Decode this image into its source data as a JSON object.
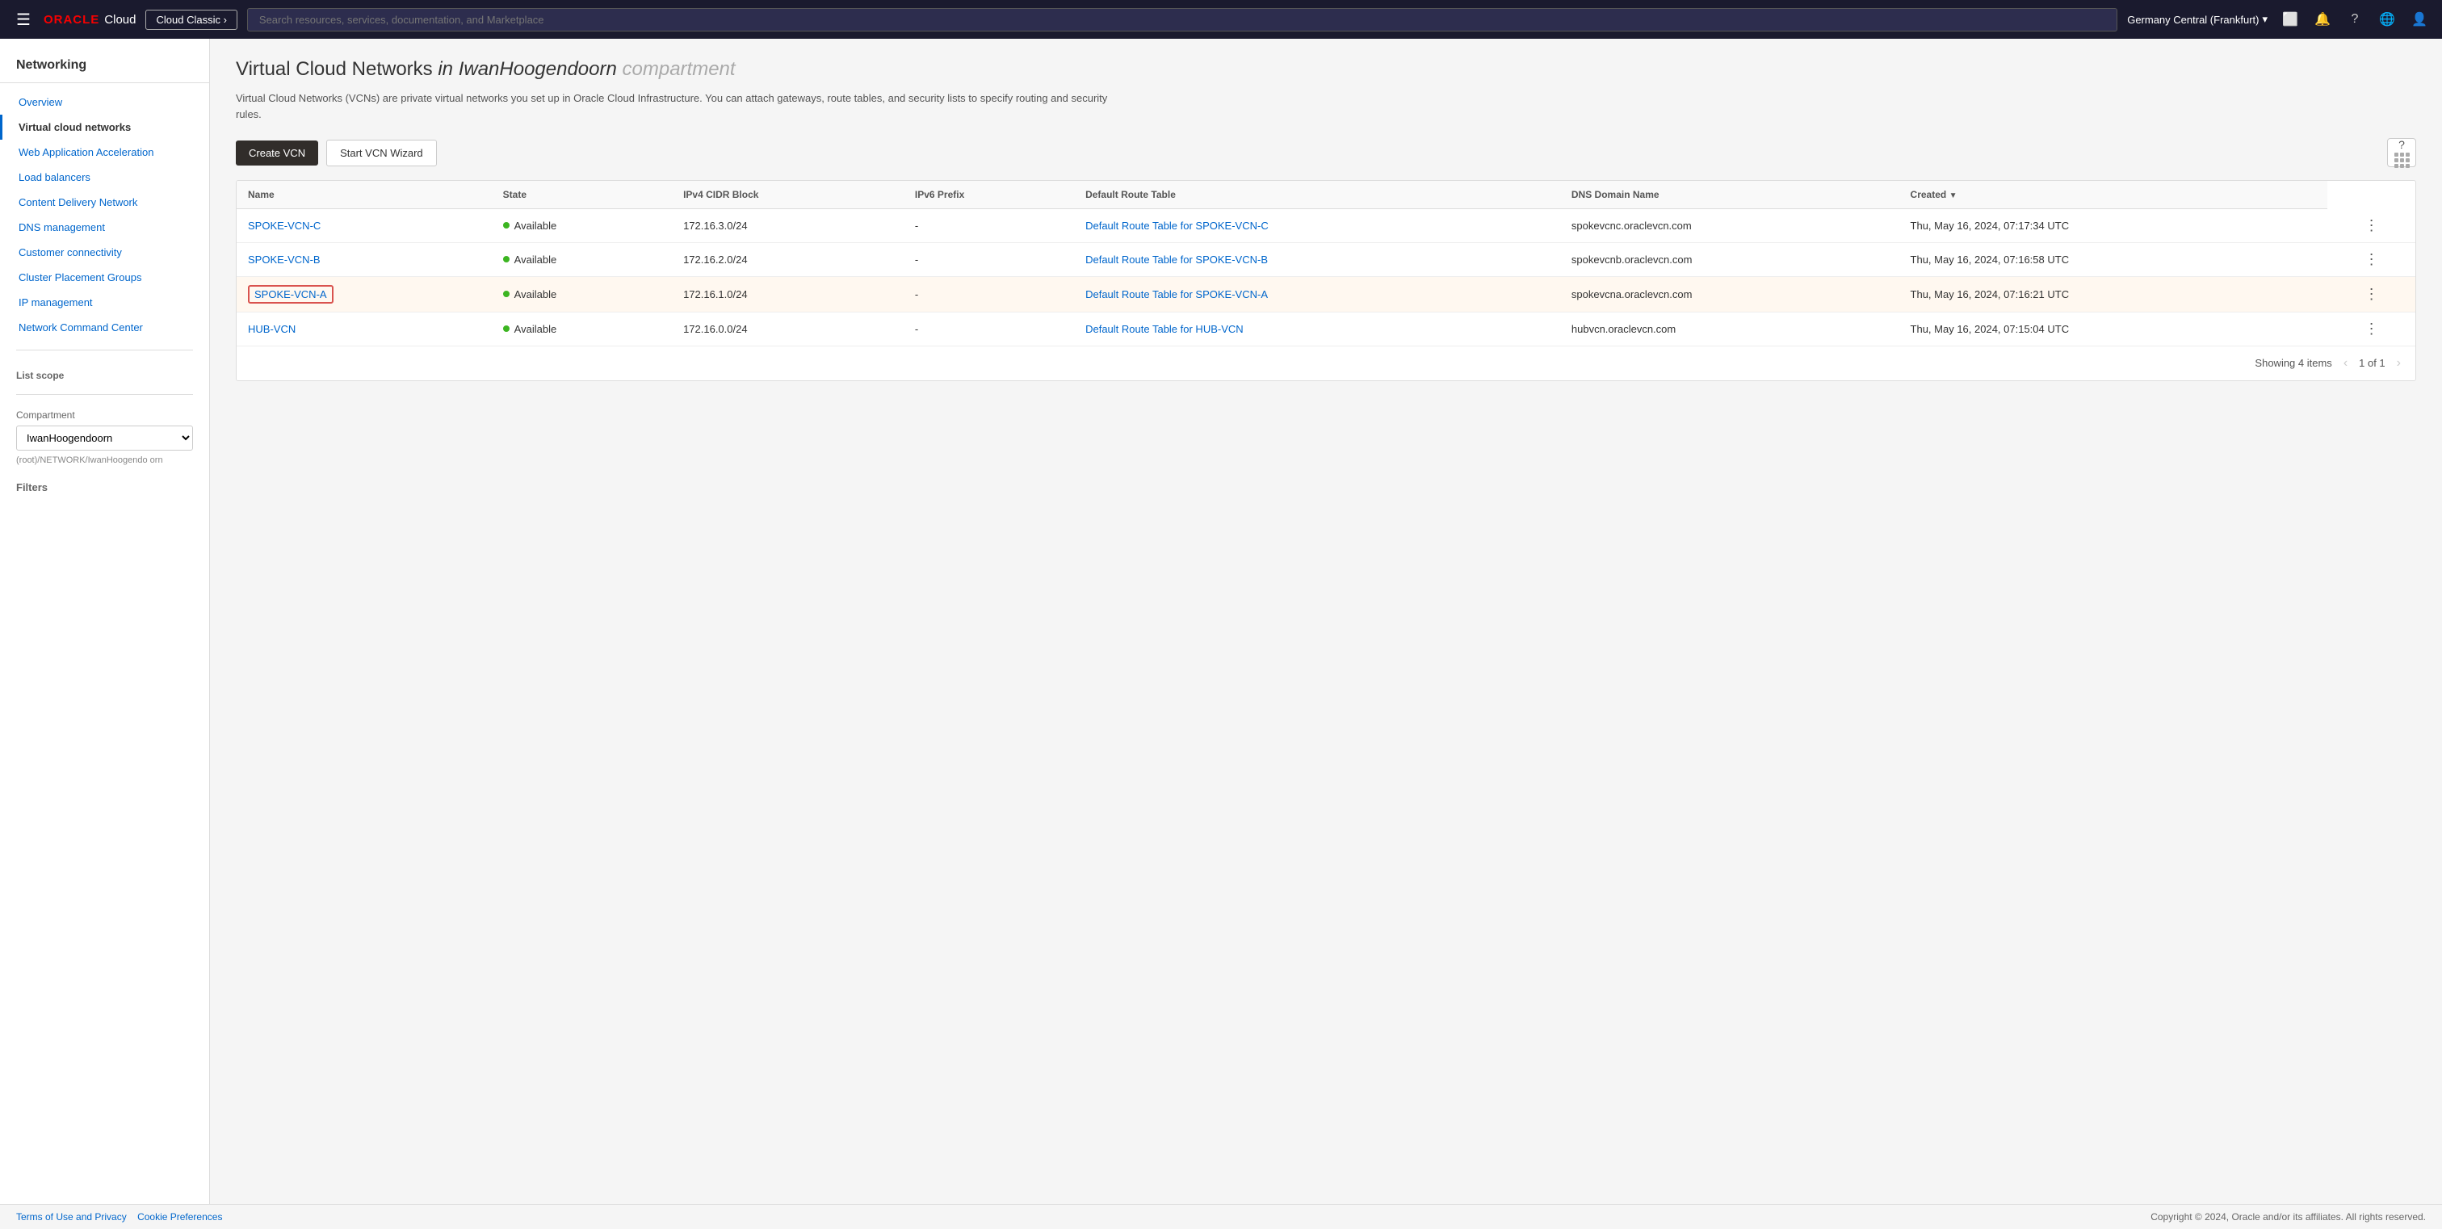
{
  "topnav": {
    "logo_oracle": "ORACLE",
    "logo_cloud": "Cloud",
    "classic_btn": "Cloud Classic ›",
    "search_placeholder": "Search resources, services, documentation, and Marketplace",
    "region": "Germany Central (Frankfurt)",
    "icons": [
      "monitor-icon",
      "bell-icon",
      "help-icon",
      "globe-icon",
      "user-icon"
    ]
  },
  "sidebar": {
    "title": "Networking",
    "items": [
      {
        "label": "Overview",
        "active": false,
        "id": "overview"
      },
      {
        "label": "Virtual cloud networks",
        "active": true,
        "id": "virtual-cloud-networks"
      },
      {
        "label": "Web Application Acceleration",
        "active": false,
        "id": "web-app-acceleration"
      },
      {
        "label": "Load balancers",
        "active": false,
        "id": "load-balancers"
      },
      {
        "label": "Content Delivery Network",
        "active": false,
        "id": "cdn"
      },
      {
        "label": "DNS management",
        "active": false,
        "id": "dns-management"
      },
      {
        "label": "Customer connectivity",
        "active": false,
        "id": "customer-connectivity"
      },
      {
        "label": "Cluster Placement Groups",
        "active": false,
        "id": "cluster-placement-groups"
      },
      {
        "label": "IP management",
        "active": false,
        "id": "ip-management"
      },
      {
        "label": "Network Command Center",
        "active": false,
        "id": "network-command-center"
      }
    ],
    "list_scope_title": "List scope",
    "compartment_label": "Compartment",
    "compartment_value": "IwanHoogendoorn",
    "compartment_path": "(root)/NETWORK/IwanHoogendo\norn",
    "filters_label": "Filters"
  },
  "page": {
    "title_prefix": "Virtual Cloud Networks",
    "title_in": "in",
    "title_compartment": "IwanHoogendoorn",
    "title_compartment_label": "compartment",
    "description": "Virtual Cloud Networks (VCNs) are private virtual networks you set up in Oracle Cloud Infrastructure. You can attach gateways, route tables, and security lists to specify routing and security rules.",
    "create_btn": "Create VCN",
    "wizard_btn": "Start VCN Wizard",
    "columns": [
      "Name",
      "State",
      "IPv4 CIDR Block",
      "IPv6 Prefix",
      "Default Route Table",
      "DNS Domain Name",
      "Created"
    ],
    "rows": [
      {
        "name": "SPOKE-VCN-C",
        "state": "Available",
        "ipv4": "172.16.3.0/24",
        "ipv6": "-",
        "route_table": "Default Route Table for SPOKE-VCN-C",
        "dns": "spokevcnc.oraclevcn.com",
        "created": "Thu, May 16, 2024, 07:17:34 UTC",
        "highlighted": false
      },
      {
        "name": "SPOKE-VCN-B",
        "state": "Available",
        "ipv4": "172.16.2.0/24",
        "ipv6": "-",
        "route_table": "Default Route Table for SPOKE-VCN-B",
        "dns": "spokevcnb.oraclevcn.com",
        "created": "Thu, May 16, 2024, 07:16:58 UTC",
        "highlighted": false
      },
      {
        "name": "SPOKE-VCN-A",
        "state": "Available",
        "ipv4": "172.16.1.0/24",
        "ipv6": "-",
        "route_table": "Default Route Table for SPOKE-VCN-A",
        "dns": "spokevcna.oraclevcn.com",
        "created": "Thu, May 16, 2024, 07:16:21 UTC",
        "highlighted": true
      },
      {
        "name": "HUB-VCN",
        "state": "Available",
        "ipv4": "172.16.0.0/24",
        "ipv6": "-",
        "route_table": "Default Route Table for HUB-VCN",
        "dns": "hubvcn.oraclevcn.com",
        "created": "Thu, May 16, 2024, 07:15:04 UTC",
        "highlighted": false
      }
    ],
    "footer": {
      "showing": "Showing 4 items",
      "pagination": "1 of 1"
    }
  },
  "footer": {
    "terms": "Terms of Use and Privacy",
    "cookies": "Cookie Preferences",
    "copyright": "Copyright © 2024, Oracle and/or its affiliates. All rights reserved."
  }
}
